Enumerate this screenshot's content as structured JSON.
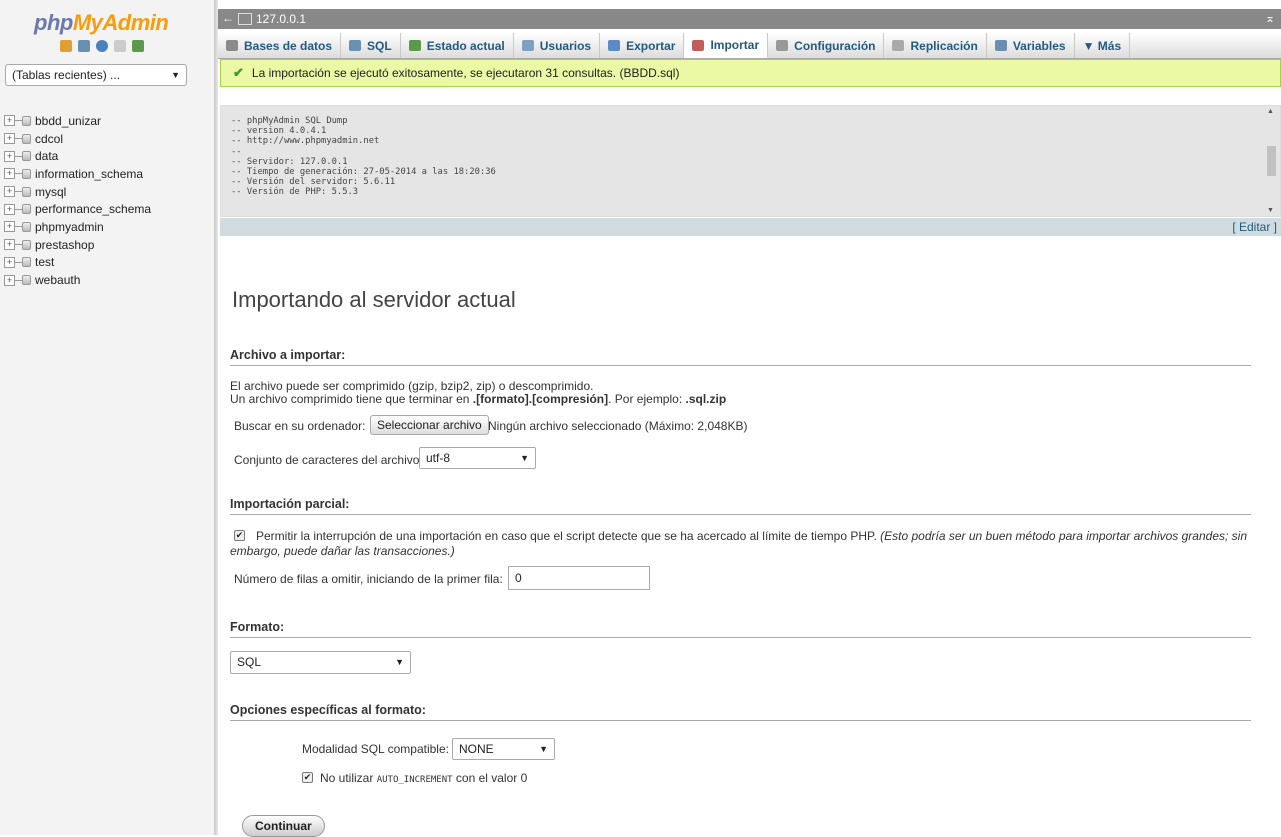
{
  "leftnav": {
    "logo_php": "php",
    "logo_my": "My",
    "logo_admin": "Admin",
    "icons": [
      "home-icon",
      "exit-icon",
      "help-icon",
      "docs-icon",
      "settings-icon"
    ],
    "recent_tables": "(Tablas recientes) ...",
    "databases": [
      "bbdd_unizar",
      "cdcol",
      "data",
      "information_schema",
      "mysql",
      "performance_schema",
      "phpmyadmin",
      "prestashop",
      "test",
      "webauth"
    ]
  },
  "serverbar": {
    "back": "←",
    "server": "127.0.0.1",
    "collapse": "⌅"
  },
  "menu": [
    {
      "label": "Bases de datos",
      "icon": "database-icon",
      "color": "#8a8a8a"
    },
    {
      "label": "SQL",
      "icon": "sql-icon",
      "color": "#6b8fb3"
    },
    {
      "label": "Estado actual",
      "icon": "status-icon",
      "color": "#5a9a4a"
    },
    {
      "label": "Usuarios",
      "icon": "users-icon",
      "color": "#7f9fc0"
    },
    {
      "label": "Exportar",
      "icon": "export-icon",
      "color": "#5c8ac4"
    },
    {
      "label": "Importar",
      "icon": "import-icon",
      "color": "#c45c5c"
    },
    {
      "label": "Configuración",
      "icon": "wrench-icon",
      "color": "#999"
    },
    {
      "label": "Replicación",
      "icon": "replication-icon",
      "color": "#aaa"
    },
    {
      "label": "Variables",
      "icon": "variables-icon",
      "color": "#6b8fb3"
    },
    {
      "label": "▼ Más",
      "icon": "",
      "color": ""
    }
  ],
  "success_message": "La importación se ejecutó exitosamente, se ejecutaron 31 consultas. (BBDD.sql)",
  "sql_dump": "-- phpMyAdmin SQL Dump\n-- version 4.0.4.1\n-- http://www.phpmyadmin.net\n--\n-- Servidor: 127.0.0.1\n-- Tiempo de generación: 27-05-2014 a las 18:20:36\n-- Versión del servidor: 5.6.11\n-- Versión de PHP: 5.5.3",
  "edit_link": "[ Editar ]",
  "page_title": "Importando al servidor actual",
  "file_section": {
    "heading": "Archivo a importar:",
    "line1": "El archivo puede ser comprimido (gzip, bzip2, zip) o descomprimido.",
    "line2_pre": "Un archivo comprimido tiene que terminar en ",
    "line2_bold": ".[formato].[compresión]",
    "line2_mid": ". Por ejemplo: ",
    "line2_example": ".sql.zip",
    "browse_label": "Buscar en su ordenador:",
    "browse_button": "Seleccionar archivo",
    "browse_status": "Ningún archivo seleccionado (Máximo: 2,048KB)",
    "charset_label": "Conjunto de caracteres del archivo:",
    "charset_value": "utf-8"
  },
  "partial_section": {
    "heading": "Importación parcial:",
    "allow_interrupt_text": "Permitir la interrupción de una importación en caso que el script detecte que se ha acercado al límite de tiempo PHP.",
    "allow_interrupt_note": "(Esto podría ser un buen método para importar archivos grandes; sin",
    "allow_interrupt_note2": "embargo, puede dañar las transacciones.)",
    "skip_label": "Número de filas a omitir, iniciando de la primer fila:",
    "skip_value": "0"
  },
  "format_section": {
    "heading": "Formato:",
    "format_value": "SQL"
  },
  "options_section": {
    "heading": "Opciones específicas al formato:",
    "compat_label": "Modalidad SQL compatible:",
    "compat_value": "NONE",
    "auto_inc_pre": "No utilizar",
    "auto_inc_code": "AUTO_INCREMENT",
    "auto_inc_post": "con el valor 0"
  },
  "continue_button": "Continuar"
}
